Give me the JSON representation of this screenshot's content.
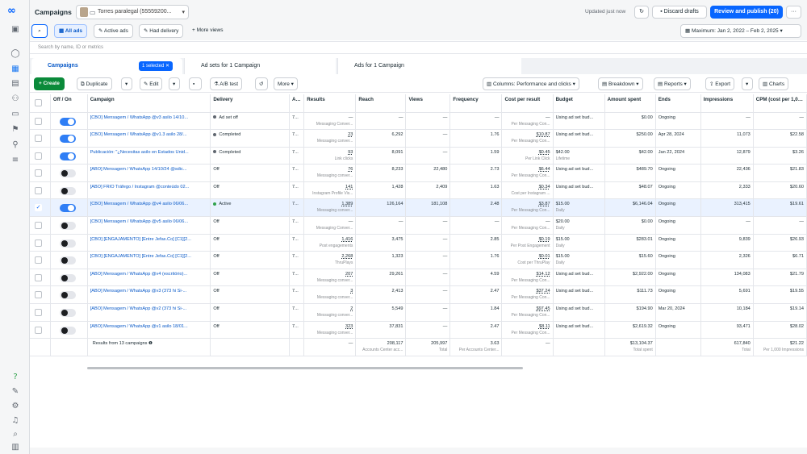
{
  "topbar": {
    "title": "Campaigns",
    "account": "Torres paralegal (55559200...",
    "updated": "Updated just now",
    "discard": "Discard drafts",
    "review": "Review and publish (20)",
    "more": "···"
  },
  "filters": {
    "all_ads": "All ads",
    "active_ads": "Active ads",
    "had_delivery": "Had delivery",
    "more_views": "+ More views",
    "date": "Maximum: Jan 2, 2022 – Feb 2, 2025"
  },
  "search": {
    "placeholder": "Search by name, ID or metrics"
  },
  "tabs": {
    "campaigns": "Campaigns",
    "selected": "1 selected ✕",
    "adsets": "Ad sets for 1 Campaign",
    "ads": "Ads for 1 Campaign"
  },
  "toolbar": {
    "create": "+ Create",
    "duplicate": "Duplicate",
    "edit": "Edit",
    "abtest": "A/B test",
    "more": "More",
    "columns": "Columns: Performance and clicks",
    "breakdown": "Breakdown",
    "reports": "Reports",
    "export": "Export",
    "charts": "Charts"
  },
  "columns": [
    "Off / On",
    "Campaign",
    "Delivery",
    "Att set",
    "Results",
    "Reach",
    "Views",
    "Frequency",
    "Cost per result",
    "Budget",
    "Amount spent",
    "Ends",
    "Impressions",
    "CPM (cost per 1,000..."
  ],
  "rows": [
    {
      "on": true,
      "campaign": "[CBO] Mensagem / WhatsApp @v3 asilo 14/10...",
      "delivery": "Ad set off",
      "dot": "#606770",
      "att": "7...",
      "results": "—",
      "results_sub": "Messaging Conver...",
      "reach": "—",
      "views": "—",
      "freq": "—",
      "cpr": "—",
      "cpr_sub": "Per Messaging Con...",
      "budget": "Using ad set bud...",
      "spent": "$0.00",
      "ends": "Ongoing",
      "impr": "—",
      "cpm": "—"
    },
    {
      "on": true,
      "campaign": "[CBO] Mensagem / WhatsApp @v1.3 asilo 28/...",
      "delivery": "Completed",
      "dot": "#606770",
      "att": "7...",
      "results": "23",
      "results_sub": "Messaging conver...",
      "reach": "6,292",
      "views": "—",
      "freq": "1.76",
      "cpr": "$10.87",
      "cpr_sub": "Per Messaging Con...",
      "budget": "Using ad set bud...",
      "spent": "$250.00",
      "ends": "Apr 28, 2024",
      "impr": "11,073",
      "cpm": "$22.58"
    },
    {
      "on": true,
      "campaign": "Publicación: \"¿Necesitas asilo en Estados Unid...",
      "delivery": "Completed",
      "dot": "#606770",
      "att": "7...",
      "results": "93",
      "results_sub": "Link clicks",
      "reach": "8,091",
      "views": "—",
      "freq": "1.59",
      "cpr": "$0.45",
      "cpr_sub": "Per Link Click",
      "budget": "$42.00",
      "budget_sub": "Lifetime",
      "spent": "$42.00",
      "ends": "Jan 22, 2024",
      "impr": "12,879",
      "cpm": "$3.26"
    },
    {
      "on": false,
      "campaign": "[ABO] Mensagem / WhatsApp 14/10/24 @sdic...",
      "delivery": "Off",
      "att": "7...",
      "results": "76",
      "results_sub": "Messaging conver...",
      "reach": "8,233",
      "views": "22,480",
      "freq": "2.73",
      "cpr": "$6.44",
      "cpr_sub": "Per Messaging Con...",
      "budget": "Using ad set bud...",
      "spent": "$489.70",
      "ends": "Ongoing",
      "impr": "22,436",
      "cpm": "$21.83"
    },
    {
      "on": false,
      "campaign": "[ABO] FRIO Tráfego / Instagram @conteúdo 02...",
      "delivery": "Off",
      "att": "7...",
      "results": "141",
      "results_sub": "Instagram Profile Vis...",
      "reach": "1,428",
      "views": "2,409",
      "freq": "1.63",
      "cpr": "$0.34",
      "cpr_sub": "Cost per Instagram ...",
      "budget": "Using ad set bud...",
      "spent": "$48.07",
      "ends": "Ongoing",
      "impr": "2,333",
      "cpm": "$20.60"
    },
    {
      "on": true,
      "sel": true,
      "campaign": "[CBO] Mensagem / WhatsApp @v4 asilo 06/06...",
      "delivery": "Active",
      "dot": "#31a24c",
      "att": "7...",
      "results": "1,389",
      "results_sub": "Messaging conver...",
      "reach": "126,164",
      "views": "181,108",
      "freq": "2.48",
      "cpr": "$3.87",
      "cpr_sub": "Per Messaging Con...",
      "budget": "$15.00",
      "budget_sub": "Daily",
      "spent": "$6,146.04",
      "ends": "Ongoing",
      "impr": "313,415",
      "cpm": "$19.61"
    },
    {
      "on": false,
      "campaign": "[CBO] Mensagem / WhatsApp @v5 asilo 06/06...",
      "delivery": "Off",
      "att": "7...",
      "results": "—",
      "results_sub": "Messaging Conver...",
      "reach": "—",
      "views": "—",
      "freq": "—",
      "cpr": "—",
      "cpr_sub": "Per Messaging Con...",
      "budget": "$20.00",
      "budget_sub": "Daily",
      "spent": "$0.00",
      "ends": "Ongoing",
      "impr": "—",
      "cpm": "—"
    },
    {
      "on": false,
      "campaign": "[CBO] [ENGAJAMENTO] [Entre Jefas.Co] [C1][2...",
      "delivery": "Off",
      "att": "7...",
      "results": "1,416",
      "results_sub": "Post engagements",
      "reach": "3,475",
      "views": "—",
      "freq": "2.85",
      "cpr": "$0.19",
      "cpr_sub": "Per Post Engagement",
      "budget": "$15.00",
      "budget_sub": "Daily",
      "spent": "$283.01",
      "ends": "Ongoing",
      "impr": "9,839",
      "cpm": "$26.93"
    },
    {
      "on": false,
      "campaign": "[CBO] [ENGAJAMENTO] [Entre Jefas.Co] [C1][2...",
      "delivery": "Off",
      "att": "7...",
      "results": "2,268",
      "results_sub": "ThruPlays",
      "reach": "1,323",
      "views": "—",
      "freq": "1.76",
      "cpr": "$0.01",
      "cpr_sub": "Cost per ThruPlay",
      "budget": "$15.00",
      "budget_sub": "Daily",
      "spent": "$15.60",
      "ends": "Ongoing",
      "impr": "2,326",
      "cpm": "$6.71"
    },
    {
      "on": false,
      "campaign": "[ABO] Mensagem / WhatsApp @v4 (escritório)...",
      "delivery": "Off",
      "att": "7...",
      "results": "207",
      "results_sub": "Messaging conver...",
      "reach": "29,261",
      "views": "—",
      "freq": "4.59",
      "cpr": "$14.12",
      "cpr_sub": "Per Messaging Con...",
      "budget": "Using ad set bud...",
      "spent": "$2,922.00",
      "ends": "Ongoing",
      "impr": "134,083",
      "cpm": "$21.79"
    },
    {
      "on": false,
      "campaign": "[ABO] Mensagem / WhatsApp @v3 (373 hi Si-...",
      "delivery": "Off",
      "att": "7...",
      "results": "3",
      "results_sub": "Messaging conver...",
      "reach": "2,413",
      "views": "—",
      "freq": "2.47",
      "cpr": "$37.24",
      "cpr_sub": "Per Messaging Con...",
      "budget": "Using ad set bud...",
      "spent": "$111.73",
      "ends": "Ongoing",
      "impr": "5,691",
      "cpm": "$19.55"
    },
    {
      "on": false,
      "campaign": "[ABO] Mensagem / WhatsApp @v2 (373 hi Si-...",
      "delivery": "Off",
      "att": "7...",
      "results": "2",
      "results_sub": "Messaging conver...",
      "reach": "5,549",
      "views": "—",
      "freq": "1.84",
      "cpr": "$97.45",
      "cpr_sub": "Per Messaging Con...",
      "budget": "Using ad set bud...",
      "spent": "$194.90",
      "ends": "Mar 20, 2024",
      "impr": "10,184",
      "cpm": "$19.14"
    },
    {
      "on": false,
      "campaign": "[ABO] Mensagem / WhatsApp @v1 asilo 18/01...",
      "delivery": "Off",
      "att": "7...",
      "results": "323",
      "results_sub": "Messaging conver...",
      "reach": "37,831",
      "views": "—",
      "freq": "2.47",
      "cpr": "$8.11",
      "cpr_sub": "Per Messaging Con...",
      "budget": "Using ad set bud...",
      "spent": "$2,619.32",
      "ends": "Ongoing",
      "impr": "93,471",
      "cpm": "$28.02"
    }
  ],
  "footer": {
    "label": "Results from 13 campaigns",
    "results": "—",
    "reach": "208,117",
    "reach_sub": "Accounts Center acc...",
    "views": "205,997",
    "views_sub": "Total",
    "freq": "3.63",
    "freq_sub": "Per Accounts Center...",
    "cpr": "—",
    "budget": "",
    "spent": "$13,104.37",
    "spent_sub": "Total spent",
    "ends": "",
    "impr": "617,840",
    "impr_sub": "Total",
    "cpm": "$21.22",
    "cpm_sub": "Per 1,000 Impressions"
  }
}
